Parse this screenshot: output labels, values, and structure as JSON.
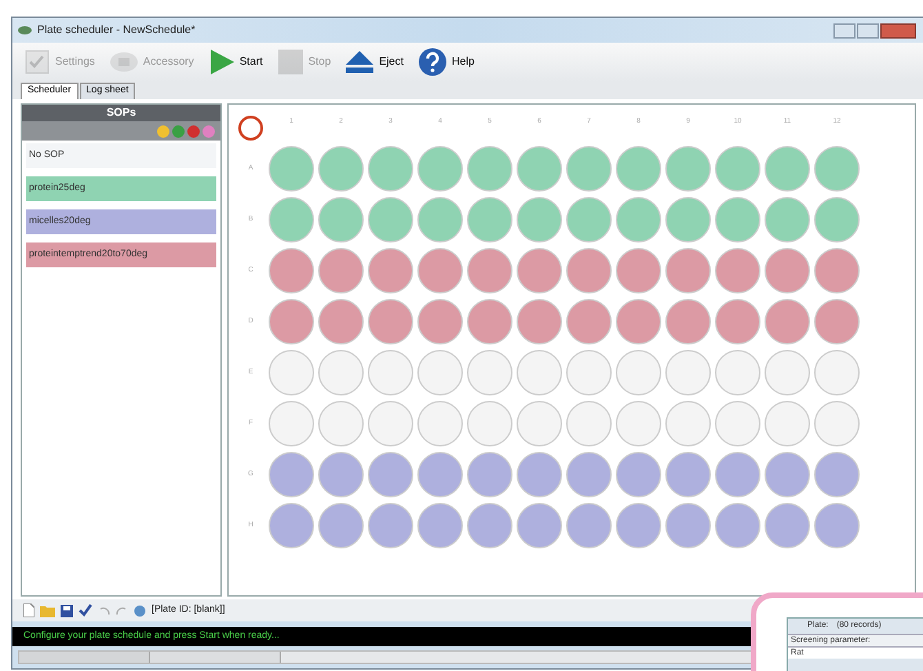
{
  "window": {
    "title": "Plate scheduler - NewSchedule*"
  },
  "toolbar": [
    {
      "label": "Settings",
      "kind": "settings",
      "disabled": true
    },
    {
      "label": "Accessory",
      "kind": "accessory",
      "disabled": true
    },
    {
      "label": "Start",
      "kind": "start",
      "disabled": false
    },
    {
      "label": "Stop",
      "kind": "stop",
      "disabled": true
    },
    {
      "label": "Eject",
      "kind": "eject",
      "disabled": false
    },
    {
      "label": "Help",
      "kind": "help",
      "disabled": false
    }
  ],
  "tabs": [
    {
      "label": "Scheduler",
      "selected": true
    },
    {
      "label": "Log sheet",
      "selected": false
    }
  ],
  "sops": {
    "title": "SOPs",
    "items": [
      {
        "label": "No SOP"
      },
      {
        "label": "protein25deg",
        "color": "#8fd3b2"
      },
      {
        "label": "micelles20deg",
        "color": "#aeb0de"
      },
      {
        "label": "proteintemptrend20to70deg",
        "color": "#dc9aa4"
      }
    ]
  },
  "plate": {
    "columns": [
      "1",
      "2",
      "3",
      "4",
      "5",
      "6",
      "7",
      "8",
      "9",
      "10",
      "11",
      "12"
    ],
    "rows": [
      {
        "label": "A",
        "color": "#8fd3b2"
      },
      {
        "label": "B",
        "color": "#8fd3b2"
      },
      {
        "label": "C",
        "color": "#dc9aa4"
      },
      {
        "label": "D",
        "color": "#dc9aa4"
      },
      {
        "label": "E",
        "color": "#f4f4f4"
      },
      {
        "label": "F",
        "color": "#f4f4f4"
      },
      {
        "label": "G",
        "color": "#aeb0de"
      },
      {
        "label": "H",
        "color": "#aeb0de"
      }
    ]
  },
  "bottom_toolbar": {
    "plate_id": "[Plate ID: [blank]]"
  },
  "status_bar": "Configure your plate schedule and press Start when ready...",
  "inset": {
    "title": "Plate:",
    "records": "(80 records)",
    "label": "Screening parameter:",
    "value": "Rat"
  }
}
